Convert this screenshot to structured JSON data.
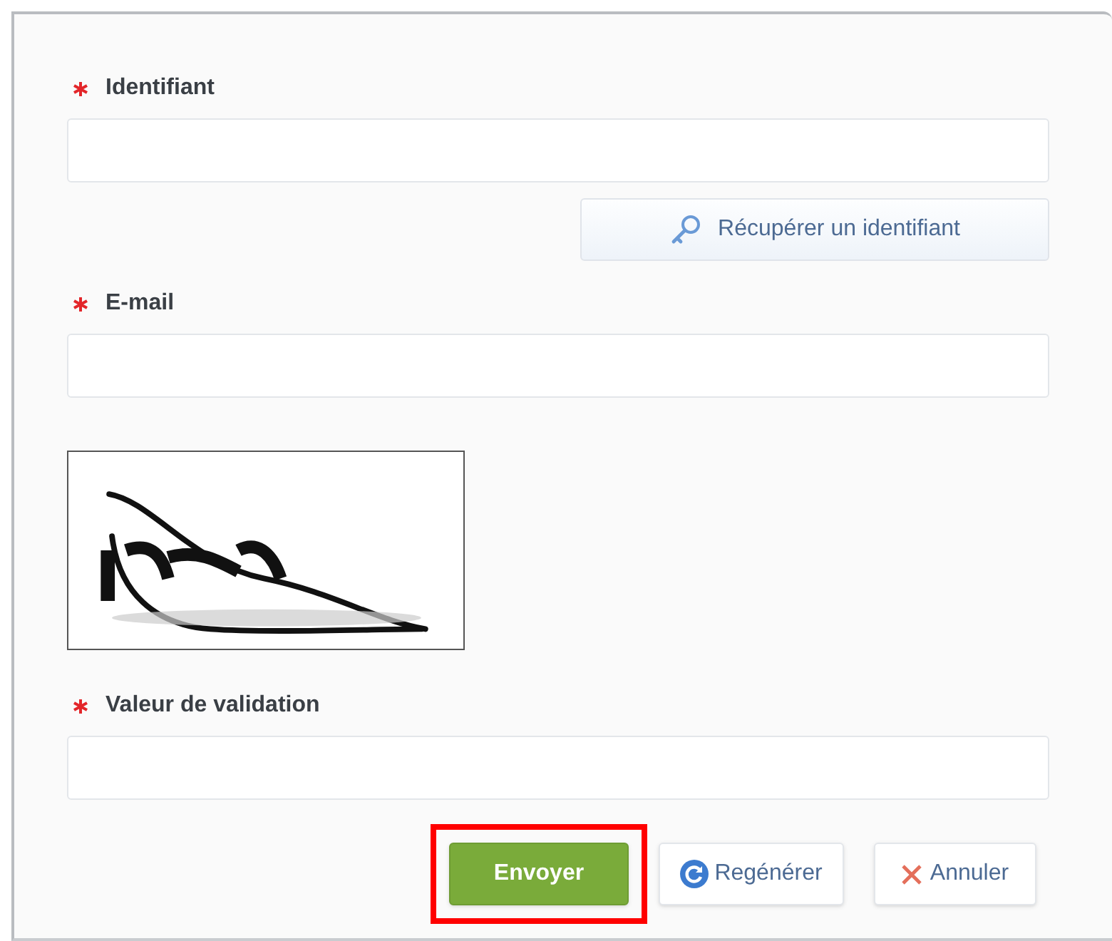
{
  "fields": [
    {
      "label": "Identifiant",
      "required": true
    },
    {
      "label": "E-mail",
      "required": true
    }
  ],
  "recover_button": {
    "label": "Récupérer un identifiant"
  },
  "validation_field": {
    "label": "Valeur de validation",
    "required": true
  },
  "buttons": [
    {
      "label": "Envoyer",
      "kind": "primary",
      "highlighted": true
    },
    {
      "label": "Regénérer",
      "kind": "refresh",
      "highlighted": false
    },
    {
      "label": "Annuler",
      "kind": "cancel",
      "highlighted": false
    }
  ]
}
